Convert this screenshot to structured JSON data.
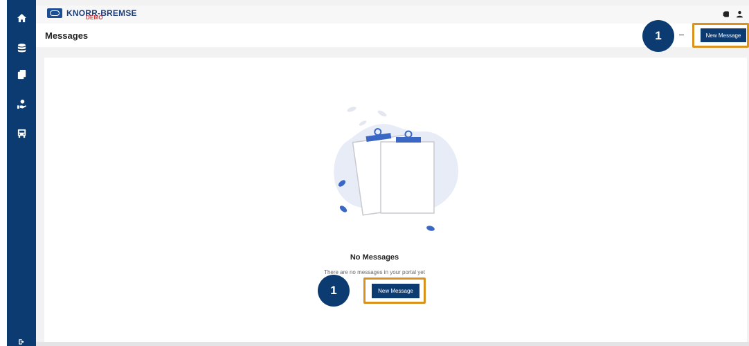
{
  "brand": {
    "name": "KNORR-BREMSE",
    "badge": "DEMO"
  },
  "page": {
    "title": "Messages"
  },
  "header": {
    "new_message_label": "New Message"
  },
  "empty_state": {
    "title": "No Messages",
    "text": "There are no messages in your portal yet",
    "button_label": "New Message"
  },
  "annotations": {
    "step_top": "1",
    "step_center": "1"
  },
  "sidebar": {
    "items": [
      {
        "icon": "home-icon"
      },
      {
        "icon": "database-icon"
      },
      {
        "icon": "documents-icon"
      },
      {
        "icon": "service-hand-icon"
      },
      {
        "icon": "vehicle-icon"
      }
    ]
  },
  "colors": {
    "sidebar": "#0b3b70",
    "button": "#0b3b70",
    "highlight": "#d9921e",
    "background": "#f2f2f3"
  }
}
